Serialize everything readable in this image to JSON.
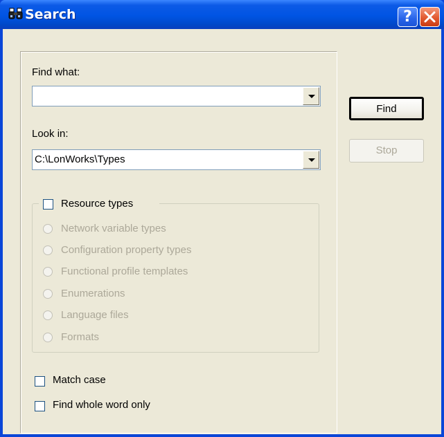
{
  "window": {
    "title": "Search",
    "help_label": "?",
    "close_label": "✕"
  },
  "form": {
    "find_what_label": "Find what:",
    "find_what_value": "",
    "look_in_label": "Look in:",
    "look_in_value": "C:\\LonWorks\\Types"
  },
  "buttons": {
    "find_label": "Find",
    "stop_label": "Stop"
  },
  "resource_types": {
    "label": "Resource types",
    "checked": false,
    "options": [
      "Network variable types",
      "Configuration property types",
      "Functional profile templates",
      "Enumerations",
      "Language files",
      "Formats"
    ]
  },
  "options": {
    "match_case_label": "Match case",
    "whole_word_label": "Find whole word only"
  },
  "icons": {
    "title": "binoculars-icon"
  }
}
